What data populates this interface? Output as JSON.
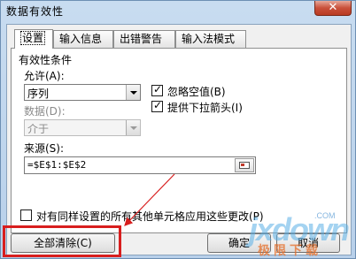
{
  "window": {
    "title": "数据有效性",
    "close_symbol": "✕"
  },
  "tabs": [
    {
      "label": "设置",
      "active": true
    },
    {
      "label": "输入信息",
      "active": false
    },
    {
      "label": "出错警告",
      "active": false
    },
    {
      "label": "输入法模式",
      "active": false
    }
  ],
  "criteria": {
    "section_title": "有效性条件",
    "allow_label": "允许(A):",
    "allow_value": "序列",
    "data_label": "数据(D):",
    "data_value": "介于",
    "ignore_blank_label": "忽略空值(B)",
    "ignore_blank_checked": true,
    "dropdown_label": "提供下拉箭头(I)",
    "dropdown_checked": true,
    "source_label": "来源(S):",
    "source_value": "=$E$1:$E$2",
    "apply_all_label": "对有同样设置的所有其他单元格应用这些更改(P)",
    "apply_all_checked": false
  },
  "buttons": {
    "clear_all": "全部清除(C)",
    "ok": "确定",
    "cancel": "取消"
  },
  "icons": {
    "close": "close-icon",
    "range_select": "range-select-icon"
  },
  "colors": {
    "highlight": "#d81e1e",
    "titlebar": "#c8dcf0"
  },
  "watermark": {
    "main": "jxdown",
    "com": ".COM",
    "sub": "极限下载"
  }
}
